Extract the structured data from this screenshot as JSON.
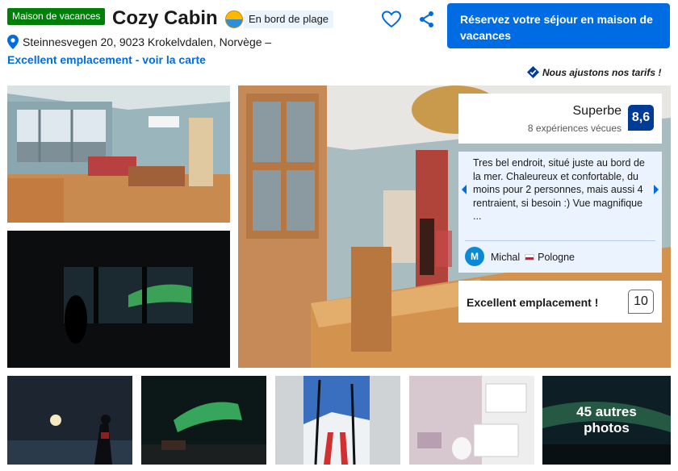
{
  "header": {
    "property_type": "Maison de vacances",
    "title": "Cozy Cabin",
    "beach_label": "En bord de plage",
    "address": "Steinnesvegen 20, 9023 Krokelvdalen, Norvège –",
    "map_link": "Excellent emplacement - voir la carte",
    "book_button": "Réservez votre séjour en maison de vacances",
    "price_match": "Nous ajustons nos tarifs !"
  },
  "review_panel": {
    "score_word": "Superbe",
    "score_count": "8 expériences vécues",
    "score_value": "8,6",
    "review_text": "Tres bel endroit, situé juste au bord de la mer. Chaleureux et confortable, du moins pour 2 personnes, mais aussi 4 rentraient, si besoin :) Vue magnifique ...",
    "reviewer_initial": "M",
    "reviewer_name": "Michal",
    "reviewer_country": "Pologne",
    "location_label": "Excellent emplacement !",
    "location_score": "10"
  },
  "gallery": {
    "more_photos": "45 autres photos"
  },
  "icons": {
    "heart": "heart-icon",
    "share": "share-icon",
    "pin": "map-pin-icon",
    "beach": "beach-icon",
    "price": "checkmark-badge-icon",
    "arrow_left": "chevron-left-icon",
    "arrow_right": "chevron-right-icon"
  },
  "colors": {
    "brand_blue": "#006ce4",
    "score_blue": "#003b95",
    "green_badge": "#008009",
    "review_bg": "#ebf3ff"
  }
}
